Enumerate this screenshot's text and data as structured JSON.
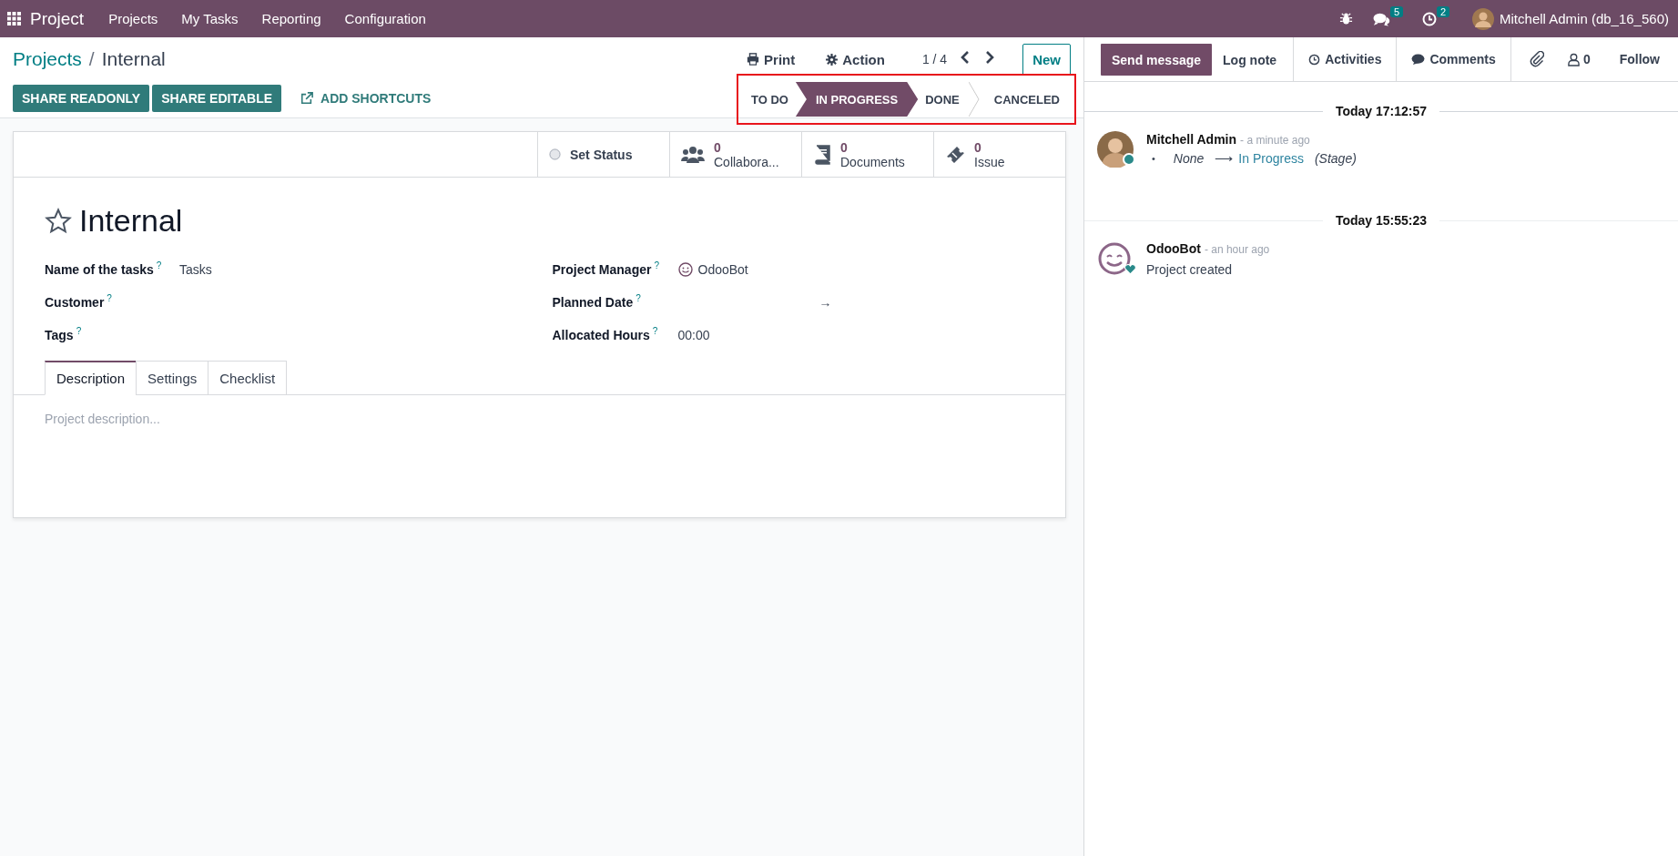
{
  "navbar": {
    "app": "Project",
    "menu": [
      {
        "label": "Projects"
      },
      {
        "label": "My Tasks"
      },
      {
        "label": "Reporting"
      },
      {
        "label": "Configuration"
      }
    ],
    "messages_badge": "5",
    "activities_badge": "2",
    "user": "Mitchell Admin (db_16_560)"
  },
  "control_panel": {
    "breadcrumb": [
      {
        "label": "Projects"
      },
      {
        "label": "Internal"
      }
    ],
    "separator": "/",
    "print": "Print",
    "action": "Action",
    "pager": "1 / 4",
    "new": "New",
    "actions": [
      {
        "label": "SHARE READONLY",
        "kind": "primary"
      },
      {
        "label": "SHARE EDITABLE",
        "kind": "primary"
      },
      {
        "label": "ADD SHORTCUTS",
        "kind": "link"
      }
    ],
    "statusbar": {
      "highlighted": true,
      "stages": [
        {
          "label": "TO DO",
          "selected": false
        },
        {
          "label": "IN PROGRESS",
          "selected": true
        },
        {
          "label": "DONE",
          "selected": false
        },
        {
          "label": "CANCELED",
          "selected": false
        }
      ]
    }
  },
  "form": {
    "smart_buttons": [
      {
        "kind": "status",
        "label": "Set Status"
      },
      {
        "kind": "collaborators",
        "count": "0",
        "label": "Collabora..."
      },
      {
        "kind": "documents",
        "count": "0",
        "label": "Documents"
      },
      {
        "kind": "issue",
        "count": "0",
        "label": "Issue"
      }
    ],
    "title": "Internal",
    "favorite": false,
    "left_fields": [
      {
        "label": "Name of the tasks",
        "help": "?",
        "value": "Tasks"
      },
      {
        "label": "Customer",
        "help": "?"
      },
      {
        "label": "Tags",
        "help": "?"
      }
    ],
    "right_fields": [
      {
        "label": "Project Manager",
        "help": "?",
        "value": "OdooBot",
        "kind": "user"
      },
      {
        "label": "Planned Date",
        "help": "?",
        "value": "→",
        "kind": "daterange"
      },
      {
        "label": "Allocated Hours",
        "help": "?",
        "value": "00:00",
        "kind": "text"
      }
    ],
    "tabs": [
      {
        "label": "Description",
        "selected": true
      },
      {
        "label": "Settings",
        "selected": false
      },
      {
        "label": "Checklist",
        "selected": false
      }
    ],
    "description_placeholder": "Project description..."
  },
  "chatter": {
    "buttons": [
      {
        "label": "Send message",
        "selected": true
      },
      {
        "label": "Log note",
        "selected": false
      }
    ],
    "activities": "Activities",
    "comments": "Comments",
    "followers": "0",
    "follow": "Follow",
    "threads": [
      {
        "date": "Today 17:12:57",
        "author": "Mitchell Admin",
        "kind": "person",
        "online": true,
        "time": "- a minute ago",
        "tracking": {
          "bullet": "•",
          "old": "None",
          "arrow": "⟶",
          "new": "In Progress",
          "field": "(Stage)"
        }
      },
      {
        "date": "Today 15:55:23",
        "author": "OdooBot",
        "kind": "bot",
        "online": false,
        "time": "- an hour ago",
        "body": "Project created"
      }
    ]
  }
}
